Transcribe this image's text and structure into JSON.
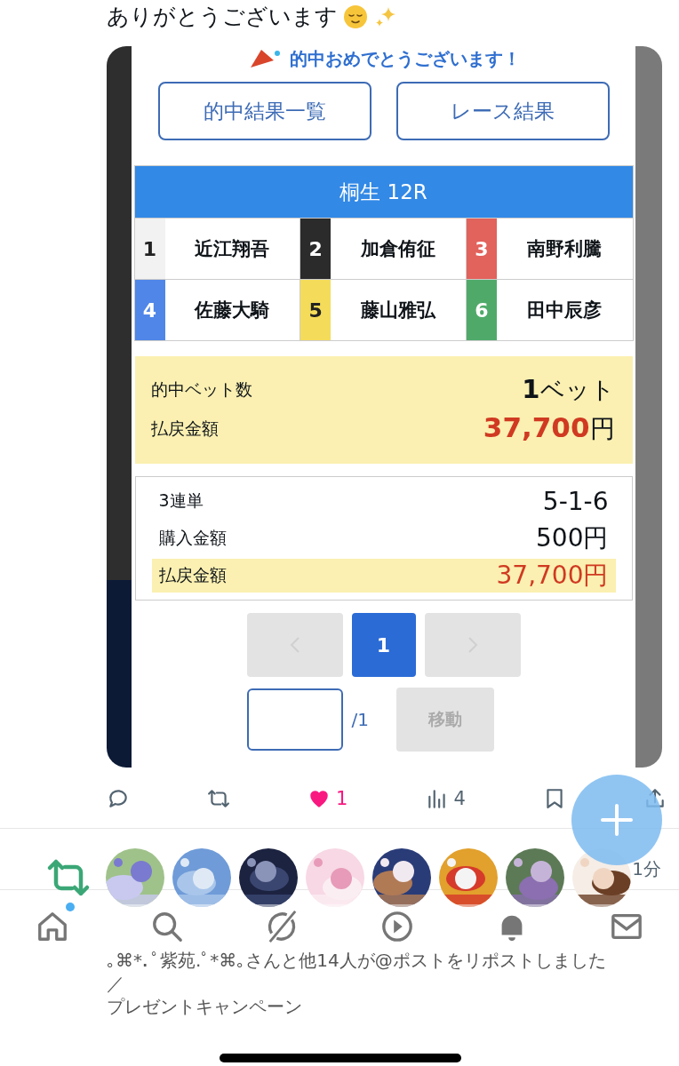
{
  "tweet": {
    "text": "ありがとうございます"
  },
  "screenshot": {
    "banner": "的中おめでとうございます！",
    "buttons": [
      "的中結果一覧",
      "レース結果"
    ],
    "race_title": "桐生 12R",
    "racers": [
      {
        "number": "1",
        "name": "近江翔吾",
        "color": "#f2f2f2"
      },
      {
        "number": "2",
        "name": "加倉侑征",
        "color": "#2b2b2b"
      },
      {
        "number": "3",
        "name": "南野利騰",
        "color": "#e2625c"
      },
      {
        "number": "4",
        "name": "佐藤大騎",
        "color": "#4f86e8"
      },
      {
        "number": "5",
        "name": "藤山雅弘",
        "color": "#f4dc5a"
      },
      {
        "number": "6",
        "name": "田中辰彦",
        "color": "#4faa6a"
      }
    ],
    "summary": {
      "bets_label": "的中ベット数",
      "bets_count": "1",
      "bets_unit": "ベット",
      "payout_label": "払戻金額",
      "payout_amount": "37,700",
      "payout_unit": "円"
    },
    "details": [
      {
        "label": "3連単",
        "value": "5-1-6",
        "highlighted": false
      },
      {
        "label": "購入金額",
        "value": "500円",
        "highlighted": false
      },
      {
        "label": "払戻金額",
        "value": "37,700円",
        "highlighted": true
      }
    ],
    "pagination": {
      "prev_disabled": true,
      "pages": [
        {
          "label": "1",
          "selected": true
        }
      ],
      "next_disabled": true
    },
    "jump": {
      "total": "/1",
      "button": "移動",
      "button_disabled": true
    }
  },
  "actions": [
    {
      "kind": "reply"
    },
    {
      "kind": "repost"
    },
    {
      "kind": "like",
      "count": "1",
      "on": true
    },
    {
      "kind": "views",
      "count": "4"
    },
    {
      "kind": "bookmark"
    },
    {
      "kind": "share"
    }
  ],
  "repost_row": {
    "time": "1分"
  },
  "notification": {
    "text": "｡⌘*.ﾟ紫苑.ﾟ*⌘｡さんと他14人が@ポストをリポストしました",
    "lines": [
      "／",
      "プレゼントキャンペーン"
    ]
  },
  "nav": [
    {
      "kind": "home",
      "badge": true
    },
    {
      "kind": "search",
      "badge": false
    },
    {
      "kind": "grok",
      "badge": false
    },
    {
      "kind": "video",
      "badge": false
    },
    {
      "kind": "notifications",
      "badge": false
    },
    {
      "kind": "messages",
      "badge": false
    }
  ]
}
